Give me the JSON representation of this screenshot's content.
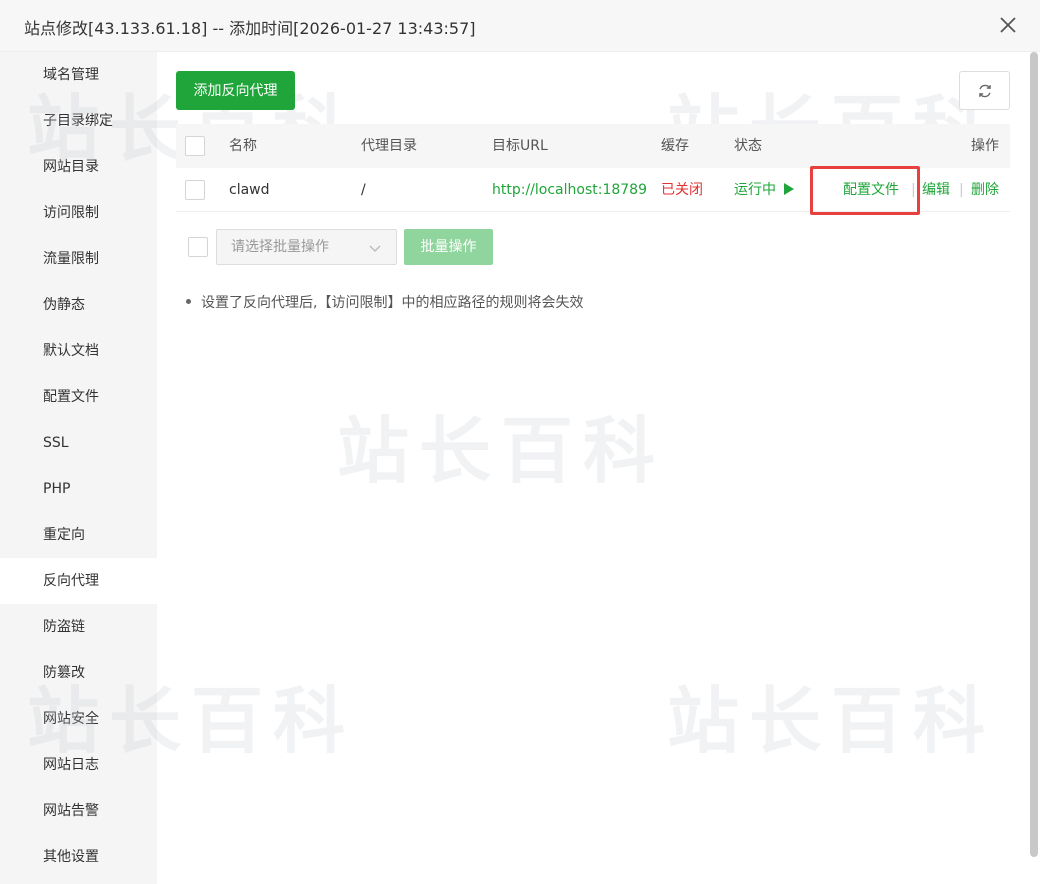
{
  "dialog": {
    "title": "站点修改[43.133.61.18] -- 添加时间[2026-01-27 13:43:57]"
  },
  "sidebar": {
    "items": [
      {
        "label": "域名管理"
      },
      {
        "label": "子目录绑定"
      },
      {
        "label": "网站目录"
      },
      {
        "label": "访问限制"
      },
      {
        "label": "流量限制"
      },
      {
        "label": "伪静态"
      },
      {
        "label": "默认文档"
      },
      {
        "label": "配置文件"
      },
      {
        "label": "SSL"
      },
      {
        "label": "PHP"
      },
      {
        "label": "重定向"
      },
      {
        "label": "反向代理",
        "active": true
      },
      {
        "label": "防盗链"
      },
      {
        "label": "防篡改"
      },
      {
        "label": "网站安全"
      },
      {
        "label": "网站日志"
      },
      {
        "label": "网站告警"
      },
      {
        "label": "其他设置"
      }
    ]
  },
  "toolbar": {
    "add_label": "添加反向代理",
    "refresh_icon": "refresh-icon"
  },
  "table": {
    "headers": {
      "name": "名称",
      "dir": "代理目录",
      "url": "目标URL",
      "cache": "缓存",
      "status": "状态",
      "ops": "操作"
    },
    "rows": [
      {
        "name": "clawd",
        "dir": "/",
        "url": "http://localhost:18789",
        "cache": "已关闭",
        "status": "运行中",
        "ops": {
          "config": "配置文件",
          "edit": "编辑",
          "delete": "删除",
          "sep": "|"
        }
      }
    ]
  },
  "batch": {
    "placeholder": "请选择批量操作",
    "button": "批量操作"
  },
  "note": "设置了反向代理后,【访问限制】中的相应路径的规则将会失效",
  "watermark": "站长百科",
  "colors": {
    "primary": "#20a53a",
    "danger": "#e13232",
    "highlight": "#e8403f"
  }
}
